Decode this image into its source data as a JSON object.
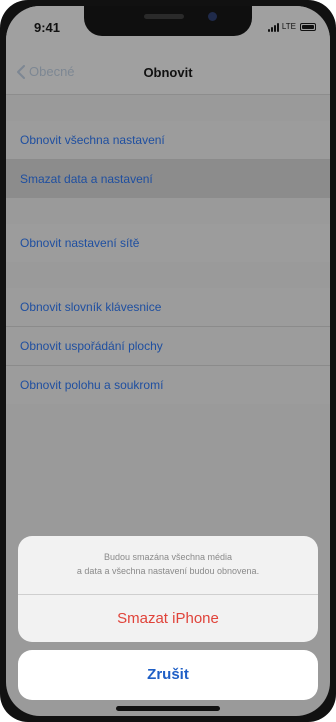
{
  "status_bar": {
    "time": "9:41",
    "network": "LTE",
    "icons": [
      "signal-icon",
      "battery-icon"
    ]
  },
  "nav": {
    "back_label": "Obecné",
    "title": "Obnovit"
  },
  "groups": [
    {
      "items": [
        {
          "label": "Obnovit všechna nastavení",
          "highlighted": false
        },
        {
          "label": "Smazat data a nastavení",
          "highlighted": true
        }
      ]
    },
    {
      "items": [
        {
          "label": "Obnovit nastavení sítě",
          "highlighted": false
        }
      ]
    },
    {
      "items": [
        {
          "label": "Obnovit slovník klávesnice",
          "highlighted": false
        },
        {
          "label": "Obnovit uspořádání plochy",
          "highlighted": false
        },
        {
          "label": "Obnovit polohu a soukromí",
          "highlighted": false
        }
      ]
    }
  ],
  "action_sheet": {
    "message_line1": "Budou smazána všechna média",
    "message_line2": "a data a všechna nastavení budou obnovena.",
    "destructive_label": "Smazat iPhone",
    "cancel_label": "Zrušit"
  },
  "colors": {
    "link": "#1f4fa0",
    "destructive": "#e0433a",
    "cancel": "#1f5fc6"
  }
}
